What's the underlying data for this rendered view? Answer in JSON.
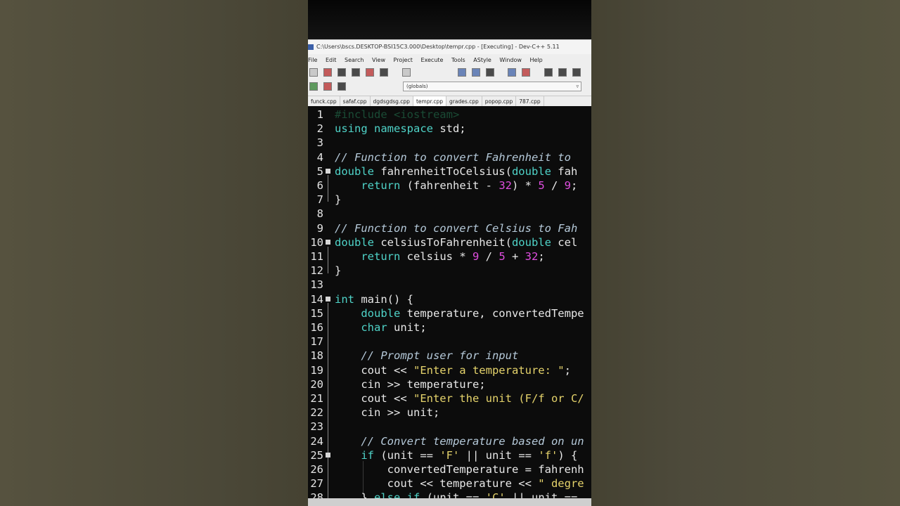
{
  "window": {
    "title": "C:\\Users\\bscs.DESKTOP-BSI15C3.000\\Desktop\\tempr.cpp - [Executing] - Dev-C++ 5.11"
  },
  "menu": [
    "File",
    "Edit",
    "Search",
    "View",
    "Project",
    "Execute",
    "Tools",
    "AStyle",
    "Window",
    "Help"
  ],
  "scope_selector": {
    "value": "(globals)"
  },
  "tabs": [
    "funck.cpp",
    "safaf.cpp",
    "dgdsgdsg.cpp",
    "tempr.cpp",
    "grades.cpp",
    "popop.cpp",
    "787.cpp"
  ],
  "active_tab": "tempr.cpp",
  "colors": {
    "keyword": "#4fd3c8",
    "number": "#e04ee0",
    "string": "#e5d36b",
    "comment": "#b5c9d9",
    "editor_bg": "#0c0c0c"
  },
  "code": {
    "lines": [
      {
        "n": "1",
        "tokens": [
          [
            "inc",
            "#include <iostream>"
          ]
        ]
      },
      {
        "n": "2",
        "tokens": [
          [
            "kw",
            "using namespace"
          ],
          [
            "",
            " std;"
          ]
        ]
      },
      {
        "n": "3",
        "tokens": []
      },
      {
        "n": "4",
        "tokens": [
          [
            "cmt",
            "// Function to convert Fahrenheit to"
          ]
        ]
      },
      {
        "n": "5",
        "fold": true,
        "tokens": [
          [
            "kw",
            "double"
          ],
          [
            "",
            " fahrenheitToCelsius("
          ],
          [
            "kw",
            "double"
          ],
          [
            "",
            " fah"
          ]
        ]
      },
      {
        "n": "6",
        "tokens": [
          [
            "",
            "    "
          ],
          [
            "kw",
            "return"
          ],
          [
            "",
            " (fahrenheit - "
          ],
          [
            "num",
            "32"
          ],
          [
            "",
            ") * "
          ],
          [
            "num",
            "5"
          ],
          [
            "",
            " / "
          ],
          [
            "num",
            "9"
          ],
          [
            "",
            ";"
          ]
        ]
      },
      {
        "n": "7",
        "tokens": [
          [
            "",
            "}"
          ]
        ]
      },
      {
        "n": "8",
        "tokens": []
      },
      {
        "n": "9",
        "tokens": [
          [
            "cmt",
            "// Function to convert Celsius to Fah"
          ]
        ]
      },
      {
        "n": "10",
        "fold": true,
        "tokens": [
          [
            "kw",
            "double"
          ],
          [
            "",
            " celsiusToFahrenheit("
          ],
          [
            "kw",
            "double"
          ],
          [
            "",
            " cel"
          ]
        ]
      },
      {
        "n": "11",
        "tokens": [
          [
            "",
            "    "
          ],
          [
            "kw",
            "return"
          ],
          [
            "",
            " celsius * "
          ],
          [
            "num",
            "9"
          ],
          [
            "",
            " / "
          ],
          [
            "num",
            "5"
          ],
          [
            "",
            " + "
          ],
          [
            "num",
            "32"
          ],
          [
            "",
            ";"
          ]
        ]
      },
      {
        "n": "12",
        "tokens": [
          [
            "",
            "}"
          ]
        ]
      },
      {
        "n": "13",
        "tokens": []
      },
      {
        "n": "14",
        "fold": true,
        "tokens": [
          [
            "kw",
            "int"
          ],
          [
            "",
            " main() {"
          ]
        ]
      },
      {
        "n": "15",
        "tokens": [
          [
            "",
            "    "
          ],
          [
            "kw",
            "double"
          ],
          [
            "",
            " temperature, convertedTempe"
          ]
        ]
      },
      {
        "n": "16",
        "tokens": [
          [
            "",
            "    "
          ],
          [
            "kw",
            "char"
          ],
          [
            "",
            " unit;"
          ]
        ]
      },
      {
        "n": "17",
        "tokens": []
      },
      {
        "n": "18",
        "tokens": [
          [
            "",
            "    "
          ],
          [
            "cmt",
            "// Prompt user for input"
          ]
        ]
      },
      {
        "n": "19",
        "tokens": [
          [
            "",
            "    cout << "
          ],
          [
            "str",
            "\"Enter a temperature: \""
          ],
          [
            "",
            ";"
          ]
        ]
      },
      {
        "n": "20",
        "tokens": [
          [
            "",
            "    cin >> temperature;"
          ]
        ]
      },
      {
        "n": "21",
        "tokens": [
          [
            "",
            "    cout << "
          ],
          [
            "str",
            "\"Enter the unit (F/f or C/"
          ]
        ]
      },
      {
        "n": "22",
        "tokens": [
          [
            "",
            "    cin >> unit;"
          ]
        ]
      },
      {
        "n": "23",
        "tokens": []
      },
      {
        "n": "24",
        "tokens": [
          [
            "",
            "    "
          ],
          [
            "cmt",
            "// Convert temperature based on un"
          ]
        ]
      },
      {
        "n": "25",
        "fold": true,
        "tokens": [
          [
            "",
            "    "
          ],
          [
            "kw",
            "if"
          ],
          [
            "",
            " (unit == "
          ],
          [
            "str",
            "'F'"
          ],
          [
            "",
            " || unit == "
          ],
          [
            "str",
            "'f'"
          ],
          [
            "",
            ") {"
          ]
        ]
      },
      {
        "n": "26",
        "tokens": [
          [
            "",
            "        convertedTemperature = fahrenh"
          ]
        ]
      },
      {
        "n": "27",
        "tokens": [
          [
            "",
            "        cout << temperature << "
          ],
          [
            "str",
            "\" degre"
          ]
        ]
      },
      {
        "n": "28",
        "tokens": [
          [
            "",
            "    } "
          ],
          [
            "kw",
            "else if"
          ],
          [
            "",
            " (unit == "
          ],
          [
            "str",
            "'C'"
          ],
          [
            "",
            " || unit =="
          ]
        ]
      }
    ]
  }
}
